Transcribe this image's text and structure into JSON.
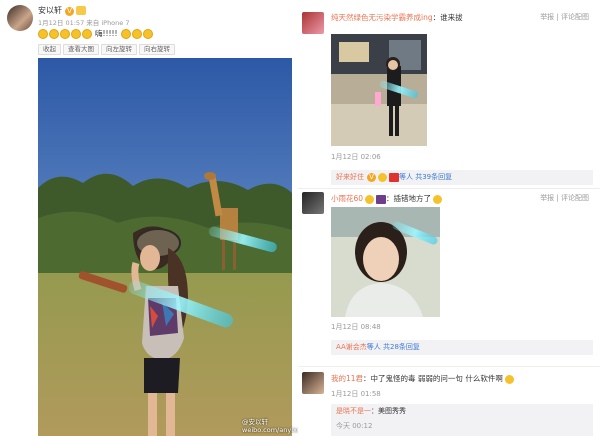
{
  "post": {
    "author": "安以轩",
    "meta": "1月12日 01:57 来自 iPhone 7",
    "text": "嗨!!!!!",
    "tools": [
      "收起",
      "查看大图",
      "向左旋转",
      "向右旋转"
    ],
    "watermark": "@安以轩\nweibo.com/anyixuan"
  },
  "comments": [
    {
      "user": "纯天然绿色无污染学霸养成ing",
      "text": "：谁来拔",
      "actions": "举报 | 评论配图",
      "time": "1月12日 02:06",
      "reply_user": "好来好住",
      "reply_text": "等人 共39条回复"
    },
    {
      "user": "小雨花60",
      "text": "：插错地方了",
      "actions": "举报 | 评论配图",
      "time": "1月12日 08:48",
      "reply_user": "AA谢会杰",
      "reply_text": "等人 共28条回复"
    },
    {
      "user": "我的11君",
      "text": "：中了鬼怪的毒 弱弱的问一句 什么软件啊",
      "time": "1月12日 01:58",
      "reply_user": "是晓不是一",
      "reply_text": "：美图秀秀",
      "reply_time": "今天 00:12"
    }
  ],
  "colors": {
    "link": "#eb7350",
    "muted": "#999999",
    "background": "#ececec"
  }
}
